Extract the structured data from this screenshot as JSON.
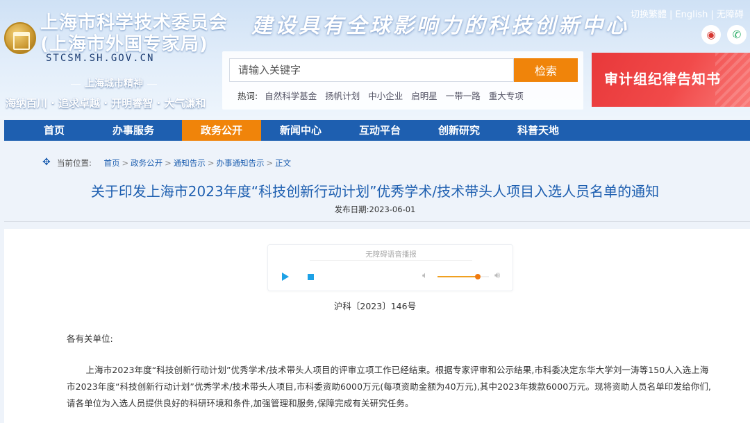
{
  "header": {
    "org_name_line1": "上海市科学技术委员会",
    "org_name_line2": "(上海市外国专家局)",
    "domain": "STCSM.SH.GOV.CN",
    "slogan": "建设具有全球影响力的科技创新中心",
    "city_spirit_title": "上海城市精神",
    "city_spirit_text": "海纳百川 · 追求卓越 · 开明睿智 · 大气谦和",
    "top_links": [
      "切换繁體",
      "English",
      "无障碍"
    ],
    "social_icons": [
      "weibo-icon",
      "wechat-icon"
    ]
  },
  "search": {
    "placeholder": "请输入关键字",
    "button_label": "检索",
    "hot_label": "热词:",
    "hot_words": [
      "自然科学基金",
      "扬帆计划",
      "中小企业",
      "启明星",
      "一带一路",
      "重大专项"
    ]
  },
  "banner": {
    "text": "审计组纪律告知书"
  },
  "nav": {
    "items": [
      "首页",
      "办事服务",
      "政务公开",
      "新闻中心",
      "互动平台",
      "创新研究",
      "科普天地"
    ],
    "active_index": 2
  },
  "breadcrumb": {
    "label": "当前位置:",
    "items": [
      "首页",
      "政务公开",
      "通知告示",
      "办事通知告示",
      "正文"
    ]
  },
  "article": {
    "title": "关于印发上海市2023年度“科技创新行动计划”优秀学术/技术带头人项目入选人员名单的通知",
    "publish_date": "发布日期:2023-06-01",
    "doc_number": "沪科〔2023〕146号",
    "salutation": "各有关单位:",
    "body": "上海市2023年度“科技创新行动计划”优秀学术/技术带头人项目的评审立项工作已经结束。根据专家评审和公示结果,市科委决定东华大学刘一涛等150人入选上海市2023年度“科技创新行动计划”优秀学术/技术带头人项目,市科委资助6000万元(每项资助金额为40万元),其中2023年拨款6000万元。现将资助人员名单印发给你们,请各单位为入选人员提供良好的科研环境和条件,加强管理和服务,保障完成有关研究任务。"
  },
  "audio": {
    "label": "无障碍语音播报",
    "volume": 0.78
  },
  "colors": {
    "nav_bg": "#1e5fb0",
    "accent_orange": "#f0840a",
    "title_blue": "#1e5fb0",
    "banner_red": "#e8383a"
  }
}
